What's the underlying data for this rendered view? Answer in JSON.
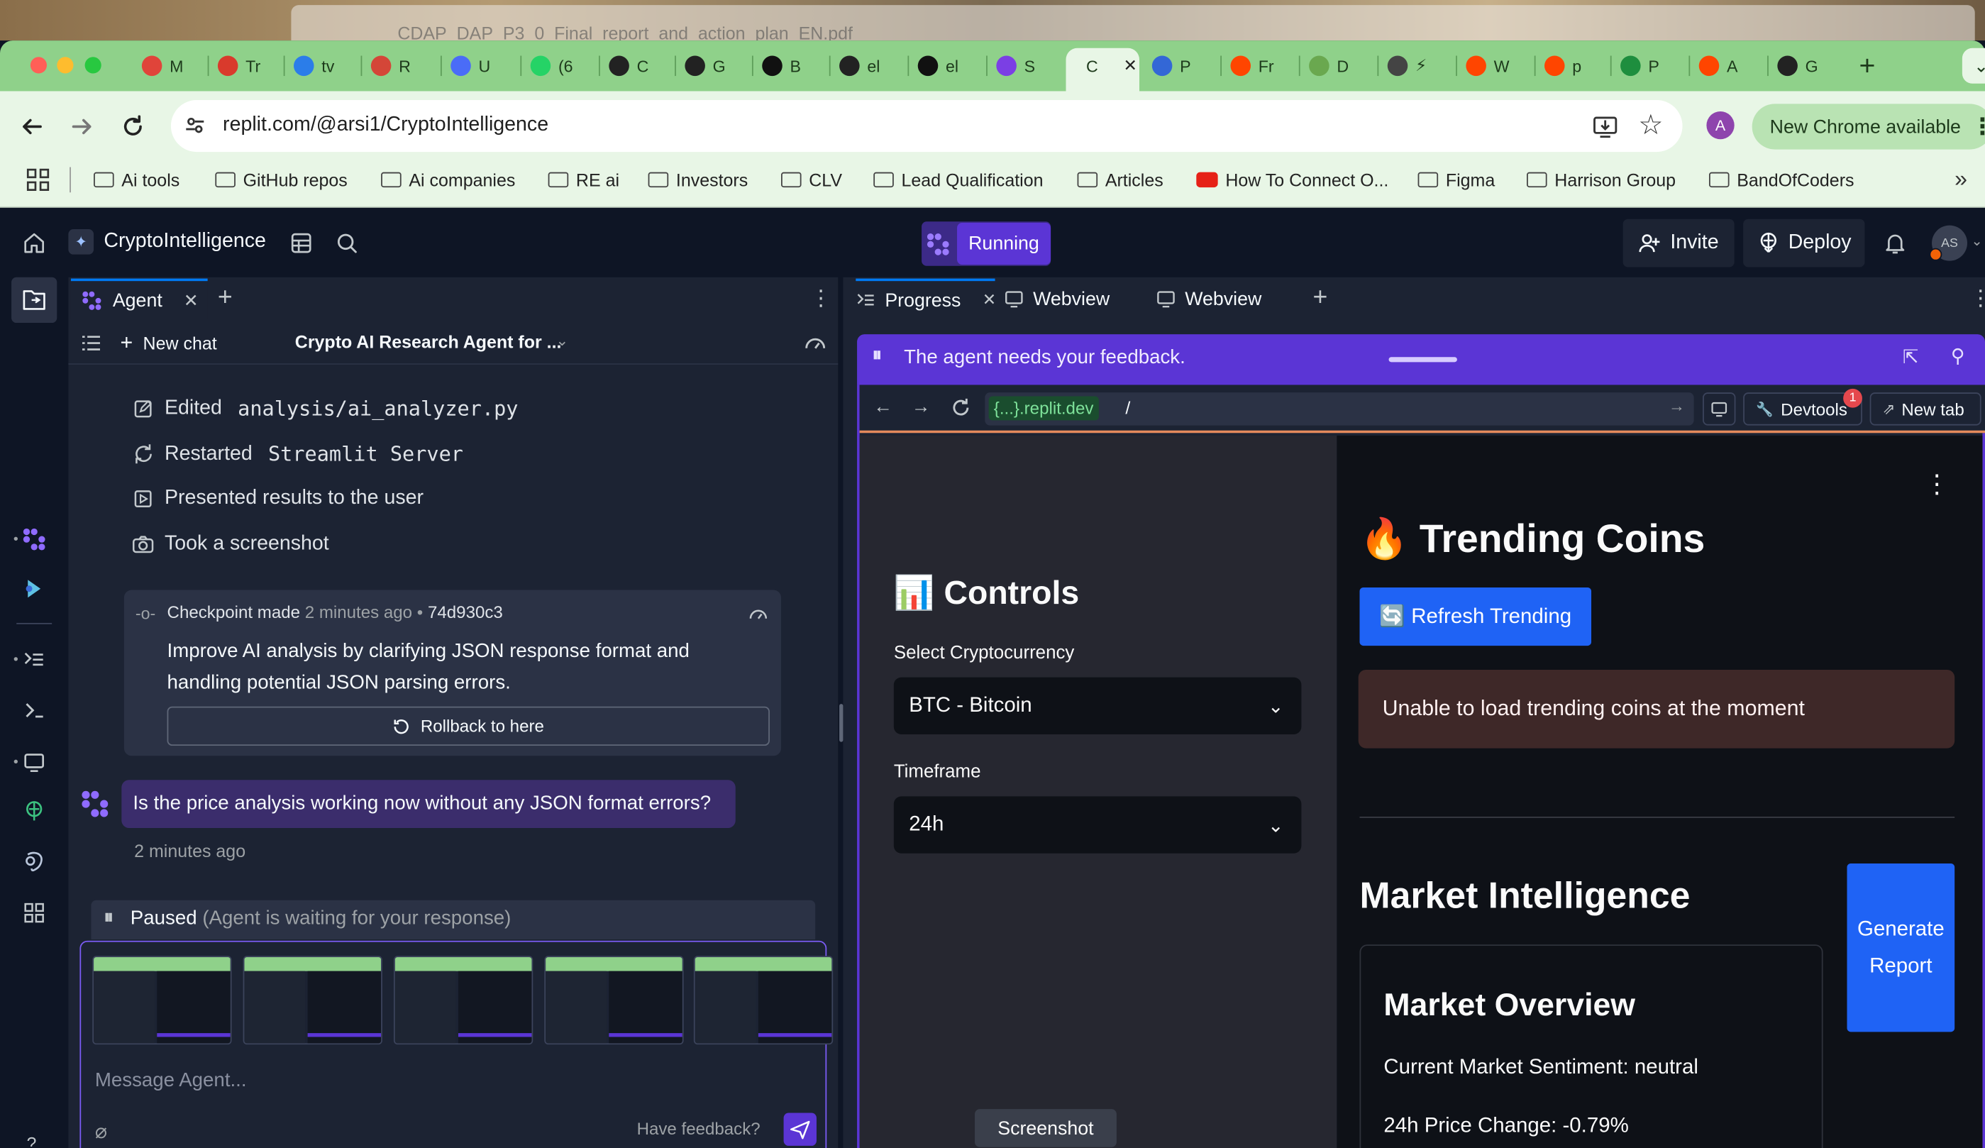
{
  "browser": {
    "window_title": "CDAP_DAP_P3_0_Final_report_and_action_plan_EN.pdf",
    "tabs": [
      {
        "label": "M",
        "icon": "m-icon",
        "color": "#e0443a"
      },
      {
        "label": "Tr",
        "icon": "target-icon",
        "color": "#d93a2c"
      },
      {
        "label": "tv",
        "icon": "cloud-icon",
        "color": "#2b7de9"
      },
      {
        "label": "R",
        "icon": "gmail-icon",
        "color": "#d44638"
      },
      {
        "label": "U",
        "icon": "doc-icon",
        "color": "#4a6cf7"
      },
      {
        "label": "(6",
        "icon": "whatsapp-icon",
        "color": "#25d366"
      },
      {
        "label": "C",
        "icon": "openai-icon",
        "color": "#222"
      },
      {
        "label": "G",
        "icon": "github-icon",
        "color": "#222"
      },
      {
        "label": "B",
        "icon": "pause-icon",
        "color": "#111"
      },
      {
        "label": "el",
        "icon": "github-icon",
        "color": "#222"
      },
      {
        "label": "el",
        "icon": "pause-icon",
        "color": "#111"
      },
      {
        "label": "S",
        "icon": "slash-icon",
        "color": "#7b3fe4"
      },
      {
        "label": "C",
        "icon": "active-tab",
        "color": "#fff"
      },
      {
        "label": "P",
        "icon": "circle-icon",
        "color": "#3367d6"
      },
      {
        "label": "Fr",
        "icon": "reddit-icon",
        "color": "#ff4500"
      },
      {
        "label": "D",
        "icon": "leaf-icon",
        "color": "#6aa84f"
      },
      {
        "label": "⚡",
        "icon": "globe-icon",
        "color": "#444"
      },
      {
        "label": "W",
        "icon": "reddit-icon",
        "color": "#ff4500"
      },
      {
        "label": "p",
        "icon": "reddit-icon",
        "color": "#ff4500"
      },
      {
        "label": "P",
        "icon": "plus-icon",
        "color": "#1e8e3e"
      },
      {
        "label": "A",
        "icon": "reddit-icon",
        "color": "#ff4500"
      },
      {
        "label": "G",
        "icon": "github-icon",
        "color": "#222"
      }
    ],
    "url": "replit.com/@arsi1/CryptoIntelligence",
    "profile_initial": "A",
    "update_label": "New Chrome available",
    "bookmarks": [
      {
        "label": "Ai tools",
        "icon": "folder-icon"
      },
      {
        "label": "GitHub repos",
        "icon": "folder-icon"
      },
      {
        "label": "Ai companies",
        "icon": "folder-icon"
      },
      {
        "label": "RE ai",
        "icon": "folder-icon"
      },
      {
        "label": "Investors",
        "icon": "folder-icon"
      },
      {
        "label": "CLV",
        "icon": "folder-icon"
      },
      {
        "label": "Lead Qualification",
        "icon": "folder-icon"
      },
      {
        "label": "Articles",
        "icon": "folder-icon"
      },
      {
        "label": "How To Connect O...",
        "icon": "youtube-icon"
      },
      {
        "label": "Figma",
        "icon": "folder-icon"
      },
      {
        "label": "Harrison Group",
        "icon": "folder-icon"
      },
      {
        "label": "BandOfCoders",
        "icon": "folder-icon"
      }
    ]
  },
  "replit": {
    "project_name": "CryptoIntelligence",
    "run_status": "Running",
    "invite_label": "Invite",
    "deploy_label": "Deploy",
    "avatar_initials": "AS"
  },
  "agent_panel": {
    "tab_label": "Agent",
    "new_chat_label": "New chat",
    "chat_title": "Crypto AI Research Agent for ...",
    "activity": [
      {
        "prefix": "Edited ",
        "code": "analysis/ai_analyzer.py",
        "icon": "edit-icon"
      },
      {
        "prefix": "Restarted ",
        "code": "Streamlit Server",
        "icon": "restart-icon"
      },
      {
        "prefix": "Presented results to the user",
        "code": "",
        "icon": "present-icon"
      },
      {
        "prefix": "Took a screenshot",
        "code": "",
        "icon": "camera-icon"
      }
    ],
    "checkpoint": {
      "label": "Checkpoint made",
      "time": "2 minutes ago",
      "sep": "•",
      "hash": "74d930c3",
      "message": "Improve AI analysis by clarifying JSON response format and handling potential JSON parsing errors.",
      "rollback_label": "Rollback to here"
    },
    "user_message": "Is the price analysis working now without any JSON format errors?",
    "user_message_time": "2 minutes ago",
    "paused_label": "Paused",
    "paused_detail": "(Agent is waiting for your response)",
    "input_placeholder": "Message Agent...",
    "feedback_label": "Have feedback?"
  },
  "right_panel": {
    "tabs": [
      {
        "label": "Progress",
        "icon": "progress-icon"
      },
      {
        "label": "Webview",
        "icon": "monitor-icon"
      },
      {
        "label": "Webview",
        "icon": "monitor-icon"
      }
    ],
    "feedback_banner": "The agent needs your feedback.",
    "webview_domain": "{...}.replit.dev",
    "webview_path": "/",
    "devtools_label": "Devtools",
    "devtools_badge": "1",
    "new_tab_label": "New tab",
    "screenshot_tooltip": "Screenshot"
  },
  "app": {
    "controls_title": "📊 Controls",
    "select_crypto_label": "Select Cryptocurrency",
    "select_crypto_value": "BTC - Bitcoin",
    "timeframe_label": "Timeframe",
    "timeframe_value": "24h",
    "trending_title": "🔥 Trending Coins",
    "refresh_label": "🔄 Refresh Trending",
    "trending_error": "Unable to load trending coins at the moment",
    "market_intel_title": "Market Intelligence",
    "generate_report_label": "Generate Report",
    "market_overview_title": "Market Overview",
    "sentiment_text": "Current Market Sentiment: neutral",
    "price_change_text": "24h Price Change: -0.79%"
  },
  "colors": {
    "chrome_green": "#8fd18a",
    "chrome_light": "#e8f6e6",
    "replit_bg": "#0e1525",
    "replit_panel": "#1c2333",
    "accent_purple": "#5b35d5",
    "streamlit_blue": "#1f63f5",
    "error_bg": "#3e2828"
  }
}
